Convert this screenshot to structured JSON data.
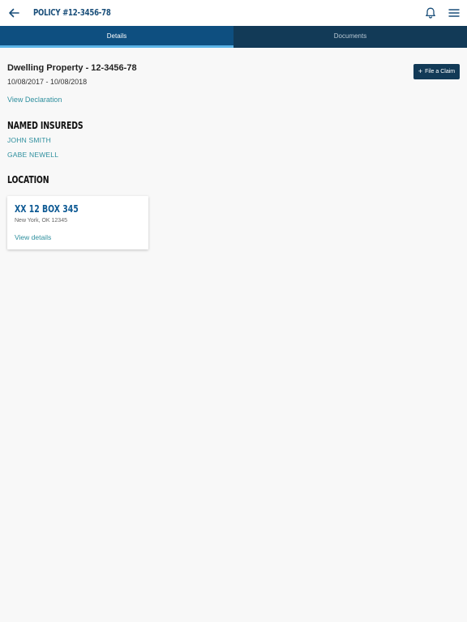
{
  "header": {
    "title": "POLICY #12-3456-78"
  },
  "tabs": [
    {
      "label": "Details",
      "active": true
    },
    {
      "label": "Documents",
      "active": false
    }
  ],
  "policy": {
    "property_title": "Dwelling Property - 12-3456-78",
    "dates": "10/08/2017 - 10/08/2018",
    "view_declaration_label": "View Declaration",
    "file_claim_label": "File a Claim"
  },
  "named_insureds": {
    "heading": "NAMED INSUREDS",
    "names": [
      "JOHN SMITH",
      "GABE NEWELL"
    ]
  },
  "location": {
    "heading": "LOCATION",
    "card": {
      "title": "XX 12 BOX 345",
      "address": "New York, OK 12345",
      "link_label": "View details"
    }
  },
  "colors": {
    "brand_dark": "#123a57",
    "tab_active": "#0e4f80",
    "tab_indicator": "#5bb3e6",
    "link": "#2e8f9e",
    "title_blue": "#1a4f7a"
  },
  "icons": {
    "back": "arrow-left-icon",
    "notifications": "bell-icon",
    "menu": "hamburger-menu-icon",
    "add": "plus-icon"
  }
}
